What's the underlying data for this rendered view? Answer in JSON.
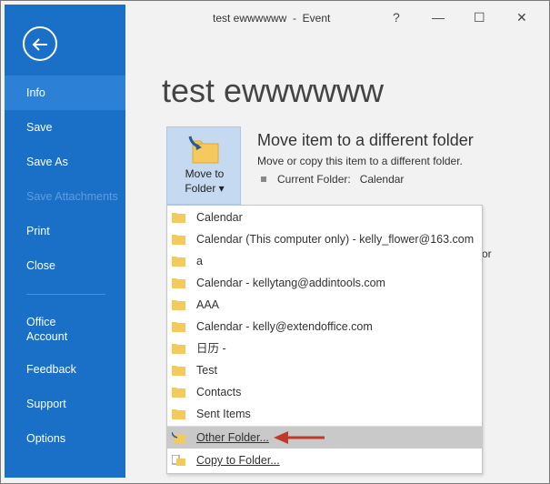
{
  "window": {
    "title": "test ewwwwww  -  Event",
    "help": "?",
    "minimize": "—",
    "maximize": "☐",
    "close": "✕"
  },
  "sidebar": {
    "items": [
      {
        "label": "Info"
      },
      {
        "label": "Save"
      },
      {
        "label": "Save As"
      },
      {
        "label": "Save Attachments"
      },
      {
        "label": "Print"
      },
      {
        "label": "Close"
      },
      {
        "label": "Office\nAccount"
      },
      {
        "label": "Feedback"
      },
      {
        "label": "Support"
      },
      {
        "label": "Options"
      }
    ]
  },
  "main": {
    "page_title": "test ewwwwww",
    "move_button": {
      "line1": "Move to",
      "line2": "Folder ▾"
    },
    "section_title": "Move item to a different folder",
    "section_desc": "Move or copy this item to a different folder.",
    "current_folder_label": "Current Folder:",
    "current_folder_value": "Calendar",
    "partial_text": "or"
  },
  "dropdown": {
    "items": [
      {
        "label": "Calendar"
      },
      {
        "label": "Calendar (This computer only) - kelly_flower@163.com"
      },
      {
        "label": "a"
      },
      {
        "label": "Calendar - kellytang@addintools.com"
      },
      {
        "label": "AAA"
      },
      {
        "label": "Calendar - kelly@extendoffice.com"
      },
      {
        "label": "日历 -"
      },
      {
        "label": "Test"
      },
      {
        "label": "Contacts"
      },
      {
        "label": "Sent Items"
      },
      {
        "label": "Other Folder..."
      },
      {
        "label": "Copy to Folder..."
      }
    ]
  },
  "colors": {
    "sidebar": "#1a6fc7",
    "sidebar_active": "#2c80d6",
    "folder": "#f4c95d",
    "arrow": "#c0392b"
  }
}
